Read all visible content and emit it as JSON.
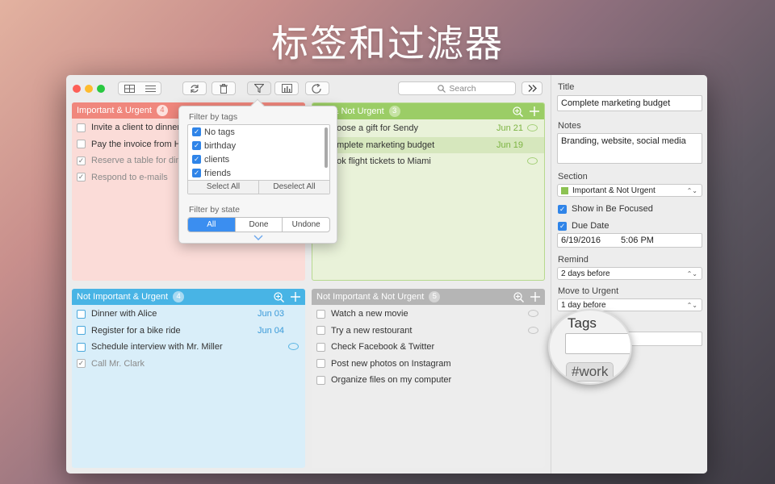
{
  "hero_title": "标签和过滤器",
  "toolbar": {
    "search_label": "Search",
    "traffic_colors": [
      "#fd5f57",
      "#febb2e",
      "#29c840"
    ]
  },
  "quadrants": [
    {
      "id": "important-urgent",
      "title": "Important & Urgent",
      "count": "4",
      "header_color": "#f0877d",
      "body_color": "#fbdcd8",
      "tasks": [
        {
          "text": "Invite a client to dinner",
          "done": false,
          "date": ""
        },
        {
          "text": "Pay the invoice from H",
          "done": false,
          "date": ""
        },
        {
          "text": "Reserve a table for dinner",
          "done": true,
          "date": ""
        },
        {
          "text": "Respond to e-mails",
          "done": true,
          "date": ""
        }
      ]
    },
    {
      "id": "important-not-urgent",
      "title": "Important & Not Urgent",
      "title_visible": "rtant & Not Urgent",
      "count": "3",
      "header_color": "#9bcd66",
      "body_color": "#e9f2d9",
      "tasks": [
        {
          "text": "Choose a gift for Sendy",
          "text_visible": "hoose a gift for Sendy",
          "done": false,
          "date": "Jun 21",
          "note": true
        },
        {
          "text": "Complete marketing budget",
          "text_visible": "omplete marketing budget",
          "done": false,
          "date": "Jun 19",
          "selected": true
        },
        {
          "text": "Book flight tickets to Miami",
          "text_visible": "ook flight tickets to Miami",
          "done": false,
          "date": "",
          "note": true
        }
      ]
    },
    {
      "id": "not-important-urgent",
      "title": "Not Important & Urgent",
      "count": "4",
      "header_color": "#48b4e5",
      "body_color": "#d9eef9",
      "tasks": [
        {
          "text": "Dinner with Alice",
          "done": false,
          "date": "Jun 03"
        },
        {
          "text": "Register for a bike ride",
          "done": false,
          "date": "Jun 04"
        },
        {
          "text": "Schedule interview with Mr. Miller",
          "done": false,
          "date": "",
          "note": true
        },
        {
          "text": "Call Mr. Clark",
          "done": true,
          "date": ""
        }
      ]
    },
    {
      "id": "not-important-not-urgent",
      "title": "Not Important & Not Urgent",
      "count": "5",
      "header_color": "#b5b5b5",
      "body_color": "#ededed",
      "tasks": [
        {
          "text": "Watch a new movie",
          "done": false,
          "date": "",
          "note": true
        },
        {
          "text": "Try a new restourant",
          "done": false,
          "date": "",
          "note": true
        },
        {
          "text": "Check Facebook & Twitter",
          "done": false,
          "date": ""
        },
        {
          "text": "Post new photos on Instagram",
          "done": false,
          "date": ""
        },
        {
          "text": "Organize files on my computer",
          "done": false,
          "date": ""
        }
      ]
    }
  ],
  "filter_popover": {
    "tags_label": "Filter by tags",
    "tags": [
      "No tags",
      "birthday",
      "clients",
      "friends"
    ],
    "select_all": "Select All",
    "deselect_all": "Deselect All",
    "state_label": "Filter by state",
    "states": [
      "All",
      "Done",
      "Undone"
    ],
    "active_state": "All"
  },
  "details": {
    "title_label": "Title",
    "title_value": "Complete marketing budget",
    "notes_label": "Notes",
    "notes_value": "Branding, website, social media",
    "section_label": "Section",
    "section_value": "Important & Not Urgent",
    "section_color": "#8cc252",
    "show_focused_label": "Show in Be Focused",
    "due_date_label": "Due Date",
    "due_date_value": "6/19/2016",
    "due_time_value": "5:06 PM",
    "remind_label": "Remind",
    "remind_value": "2 days before",
    "move_label": "Move to Urgent",
    "move_value": "1 day before",
    "tags_label": "Tags",
    "tag_chip": "#work"
  }
}
